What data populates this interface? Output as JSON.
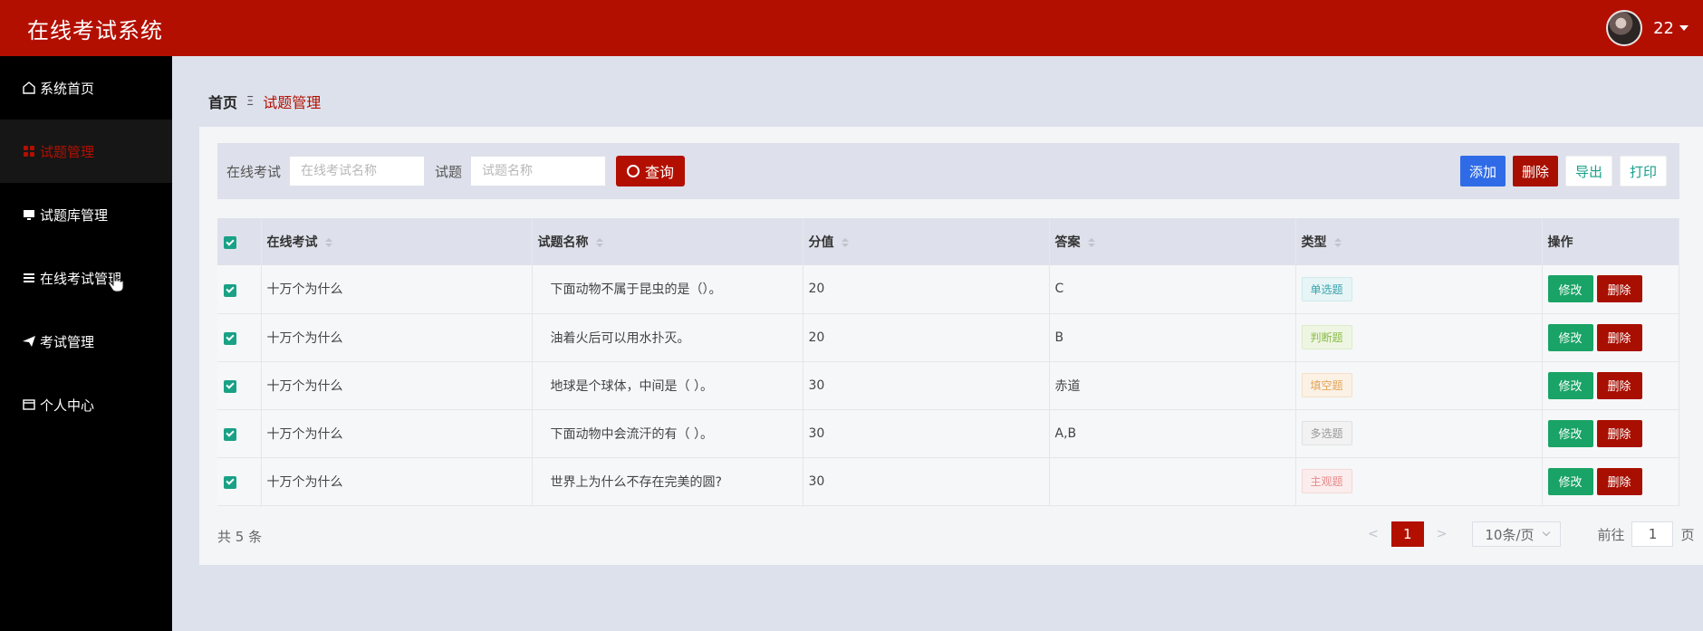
{
  "header": {
    "app_title": "在线考试系统",
    "username": "22"
  },
  "sidebar": {
    "items": [
      {
        "label": "系统首页",
        "icon": "home-icon"
      },
      {
        "label": "试题管理",
        "icon": "grid-icon",
        "active": true
      },
      {
        "label": "试题库管理",
        "icon": "monitor-icon"
      },
      {
        "label": "在线考试管理",
        "icon": "list-icon"
      },
      {
        "label": "考试管理",
        "icon": "send-icon"
      },
      {
        "label": "个人中心",
        "icon": "card-icon"
      }
    ]
  },
  "breadcrumb": {
    "home": "首页",
    "sep": "Ξ",
    "current": "试题管理"
  },
  "search": {
    "exam_label": "在线考试",
    "exam_placeholder": "在线考试名称",
    "question_label": "试题",
    "question_placeholder": "试题名称",
    "query_button": "查询"
  },
  "toolbar": {
    "add": "添加",
    "delete": "删除",
    "export": "导出",
    "print": "打印"
  },
  "table": {
    "headers": {
      "exam": "在线考试",
      "question": "试题名称",
      "score": "分值",
      "answer": "答案",
      "type": "类型",
      "ops": "操作"
    },
    "rows": [
      {
        "exam": "十万个为什么",
        "question": "下面动物不属于昆虫的是（）。",
        "score": "20",
        "answer": "C",
        "type": "单选题",
        "type_class": "tag-single"
      },
      {
        "exam": "十万个为什么",
        "question": "油着火后可以用水扑灭。",
        "score": "20",
        "answer": "B",
        "type": "判断题",
        "type_class": "tag-judge"
      },
      {
        "exam": "十万个为什么",
        "question": "地球是个球体，中间是（ ）。",
        "score": "30",
        "answer": "赤道",
        "type": "填空题",
        "type_class": "tag-blank"
      },
      {
        "exam": "十万个为什么",
        "question": "下面动物中会流汗的有（ ）。",
        "score": "30",
        "answer": "A,B",
        "type": "多选题",
        "type_class": "tag-multi"
      },
      {
        "exam": "十万个为什么",
        "question": "世界上为什么不存在完美的圆?",
        "score": "30",
        "answer": "",
        "type": "主观题",
        "type_class": "tag-subj"
      }
    ],
    "edit_label": "修改",
    "delete_label": "删除"
  },
  "pagination": {
    "total": "共 5 条",
    "current": "1",
    "page_size": "10条/页",
    "goto_label": "前往",
    "goto_value": "1",
    "page_suffix": "页",
    "prev": "<",
    "next": ">"
  },
  "colors": {
    "brand": "#b30f00",
    "add": "#2f6be6",
    "edit": "#1aa366"
  }
}
